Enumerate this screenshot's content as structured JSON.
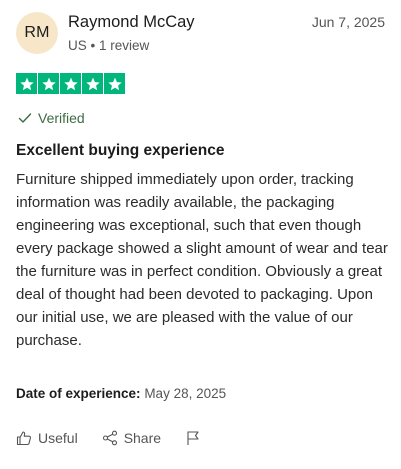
{
  "review": {
    "avatar_initials": "RM",
    "reviewer_name": "Raymond McCay",
    "reviewer_meta": "US • 1 review",
    "date": "Jun 7, 2025",
    "rating": 5,
    "rating_max": 5,
    "verified_label": "Verified",
    "title": "Excellent buying experience",
    "body": "Furniture shipped immediately upon order, tracking information was readily available, the packaging engineering was exceptional, such that even though every package showed a slight amount of wear and tear the furniture was in perfect condition. Obviously a great deal of thought had been devoted to packaging. Upon our initial use, we are pleased with the value of our purchase.",
    "experience_label": "Date of experience:",
    "experience_date": "May 28, 2025"
  },
  "actions": {
    "useful_label": "Useful",
    "share_label": "Share"
  },
  "colors": {
    "star_green": "#00b67a",
    "avatar_bg": "#f7e7c8",
    "verified_green": "#3d6b44"
  },
  "icons": [
    "star-icon",
    "check-icon",
    "thumbs-up-icon",
    "share-icon",
    "flag-icon"
  ]
}
